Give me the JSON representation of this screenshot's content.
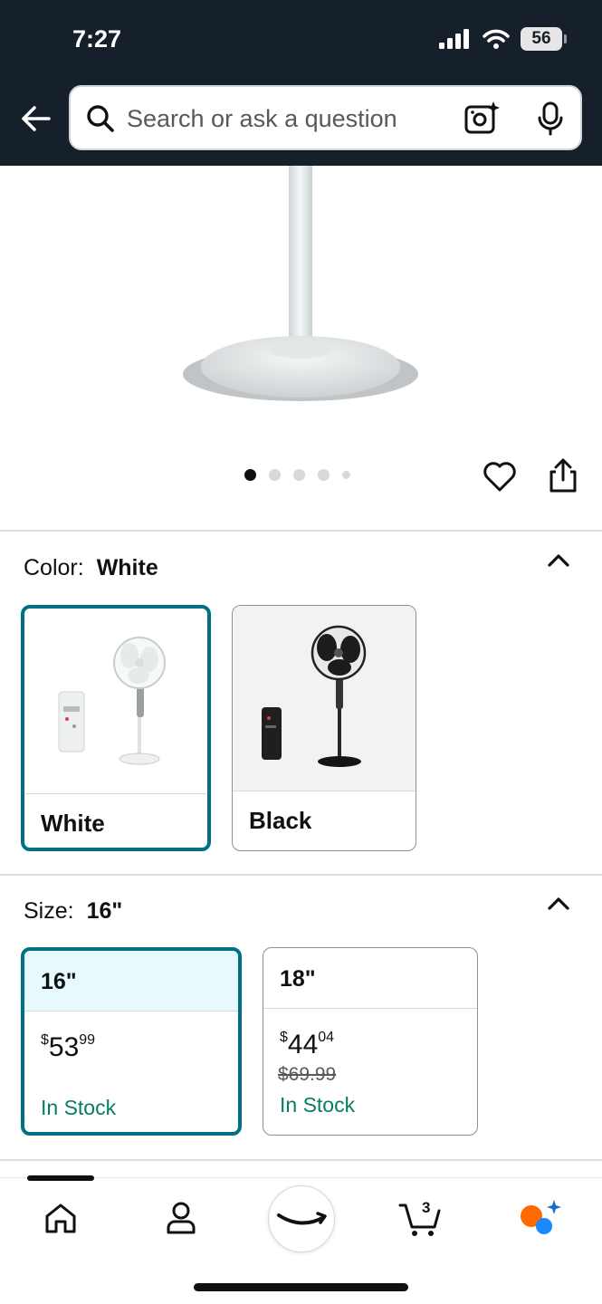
{
  "status": {
    "time": "7:27",
    "battery": "56"
  },
  "search": {
    "placeholder": "Search or ask a question"
  },
  "gallery": {
    "dot_count": 5,
    "active_index": 0
  },
  "color": {
    "label": "Color:",
    "selected": "White",
    "options": [
      {
        "name": "White"
      },
      {
        "name": "Black"
      }
    ]
  },
  "size": {
    "label": "Size:",
    "selected": "16\"",
    "options": [
      {
        "name": "16\"",
        "price_symbol": "$",
        "price_whole": "53",
        "price_frac": "99",
        "list_price": "",
        "stock": "In Stock"
      },
      {
        "name": "18\"",
        "price_symbol": "$",
        "price_whole": "44",
        "price_frac": "04",
        "list_price": "$69.99",
        "stock": "In Stock"
      }
    ]
  },
  "nav": {
    "cart_count": "3"
  },
  "colors": {
    "header": "#16202a",
    "accent": "#007185",
    "stock": "#067d62",
    "selected_bg": "#e6f9fc"
  }
}
